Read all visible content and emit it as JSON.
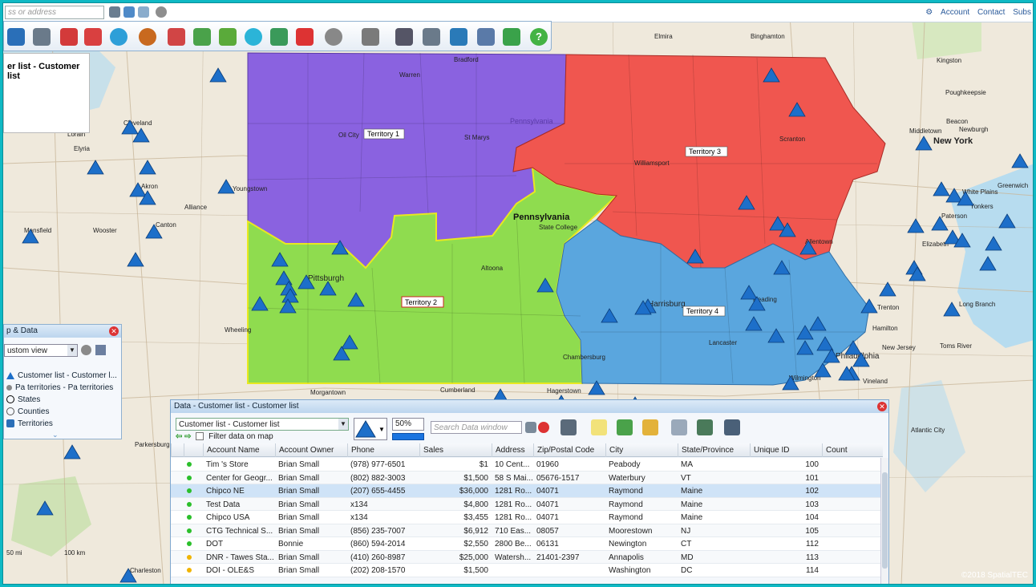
{
  "topbar": {
    "address_placeholder": "ss or address",
    "links": [
      "Account",
      "Contact",
      "Subs"
    ]
  },
  "toolbar": {
    "icons": [
      "save-icon",
      "users-icon",
      "add-pin-icon",
      "puzzle-icon",
      "globe-icon",
      "target-icon",
      "split-icon",
      "balls-icon",
      "layers-icon",
      "radar-icon",
      "shuffle-icon",
      "delete-icon",
      "zoom-icon",
      "label-icon",
      "ruler-icon",
      "print-icon",
      "export-icon",
      "grid-icon",
      "money-icon",
      "help-icon"
    ]
  },
  "left_panel": {
    "title": "er list - Customer list"
  },
  "map_data_panel": {
    "title": "p & Data",
    "view_select": "ustom view",
    "layers": [
      {
        "label": "Customer list - Customer l...",
        "icon": "triangle-icon"
      },
      {
        "label": "Pa territories - Pa territories",
        "icon": "dot-icon"
      },
      {
        "label": "States",
        "icon": "circle-icon"
      },
      {
        "label": "Counties",
        "icon": "circle-icon"
      },
      {
        "label": "Territories",
        "icon": "puzzle-icon"
      }
    ]
  },
  "map": {
    "state_label": "Pennsylvania",
    "territories": [
      "Territory 1",
      "Territory 2",
      "Territory 3",
      "Territory 4"
    ],
    "places": [
      "Bradford",
      "Warren",
      "Oil City",
      "St Marys",
      "Pennsylvania",
      "Williamsport",
      "Scranton",
      "State College",
      "Altoona",
      "Pittsburgh",
      "Harrisburg",
      "Lancaster",
      "Chambersburg",
      "Reading",
      "Cumberland",
      "Hagerstown",
      "Morgantown",
      "Wheeling",
      "Youngstown",
      "Akron",
      "Canton",
      "Cleveland",
      "Elyria",
      "Lorain",
      "Wooster",
      "Mansfield",
      "Alliance",
      "Elmira",
      "Binghamton",
      "Kingston",
      "Poughkeepsie",
      "Middletown",
      "Beacon",
      "Newburgh",
      "New York",
      "Trenton",
      "Long Branch",
      "Toms River",
      "Philadelphia",
      "Wilmington",
      "Atlantic City",
      "Charleston",
      "Parkersburg",
      "New Jersey",
      "Paterson",
      "Elizabeth",
      "White Plains",
      "Yonkers",
      "Greenwich",
      "Hamilton",
      "Allentown",
      "Vineland"
    ],
    "scale_label": "100 km",
    "scale_label2": "50 mi",
    "copyright": "©2018 SpatialTEC"
  },
  "data_window": {
    "title": "Data - Customer list - Customer list",
    "source_select": "Customer list - Customer list",
    "filter_label": "Filter data on map",
    "size_percent": "50%",
    "search_placeholder": "Search Data window",
    "columns": [
      "Account Name",
      "Account Owner",
      "Phone",
      "Sales",
      "Address",
      "Zip/Postal Code",
      "City",
      "State/Province",
      "Unique ID",
      "Count"
    ],
    "rows": [
      {
        "dot": "#2bbf2b",
        "name": "Tim 's Store",
        "owner": "Brian Small",
        "phone": "(978) 977-6501",
        "sales": "$1",
        "address": "10 Cent...",
        "zip": "01960",
        "city": "Peabody",
        "state": "MA",
        "id": "100"
      },
      {
        "dot": "#2bbf2b",
        "name": "Center for Geogr...",
        "owner": "Brian Small",
        "phone": "(802) 882-3003",
        "sales": "$1,500",
        "address": "58 S Mai...",
        "zip": "05676-1517",
        "city": "Waterbury",
        "state": "VT",
        "id": "101"
      },
      {
        "dot": "#2bbf2b",
        "name": "Chipco NE",
        "owner": "Brian Small",
        "phone": "(207) 655-4455",
        "sales": "$36,000",
        "address": "1281 Ro...",
        "zip": "04071",
        "city": "Raymond",
        "state": "Maine",
        "id": "102"
      },
      {
        "dot": "#2bbf2b",
        "name": "Test Data",
        "owner": "Brian Small",
        "phone": "x134",
        "sales": "$4,800",
        "address": "1281 Ro...",
        "zip": "04071",
        "city": "Raymond",
        "state": "Maine",
        "id": "103"
      },
      {
        "dot": "#2bbf2b",
        "name": "Chipco USA",
        "owner": "Brian Small",
        "phone": "x134",
        "sales": "$3,455",
        "address": "1281 Ro...",
        "zip": "04071",
        "city": "Raymond",
        "state": "Maine",
        "id": "104"
      },
      {
        "dot": "#2bbf2b",
        "name": "CTG Technical S...",
        "owner": "Brian Small",
        "phone": "(856) 235-7007",
        "sales": "$6,912",
        "address": "710 Eas...",
        "zip": "08057",
        "city": "Moorestown",
        "state": "NJ",
        "id": "105"
      },
      {
        "dot": "#2bbf2b",
        "name": "DOT",
        "owner": "Bonnie",
        "phone": "(860) 594-2014",
        "sales": "$2,550",
        "address": "2800 Be...",
        "zip": "06131",
        "city": "Newington",
        "state": "CT",
        "id": "112"
      },
      {
        "dot": "#f0b400",
        "name": "DNR - Tawes Sta...",
        "owner": "Brian Small",
        "phone": "(410) 260-8987",
        "sales": "$25,000",
        "address": "Watersh...",
        "zip": "21401-2397",
        "city": "Annapolis",
        "state": "MD",
        "id": "113"
      },
      {
        "dot": "#f0b400",
        "name": "DOI - OLE&S",
        "owner": "Brian Small",
        "phone": "(202) 208-1570",
        "sales": "$1,500",
        "address": "",
        "zip": "",
        "city": "Washington",
        "state": "DC",
        "id": "114"
      }
    ]
  },
  "colors": {
    "territory1": "#8a62e0",
    "territory2": "#8fdc4f",
    "territory3": "#f0564f",
    "territory4": "#5aa6de",
    "marker": "#1d6fc9",
    "frame": "#0fb9c4"
  }
}
